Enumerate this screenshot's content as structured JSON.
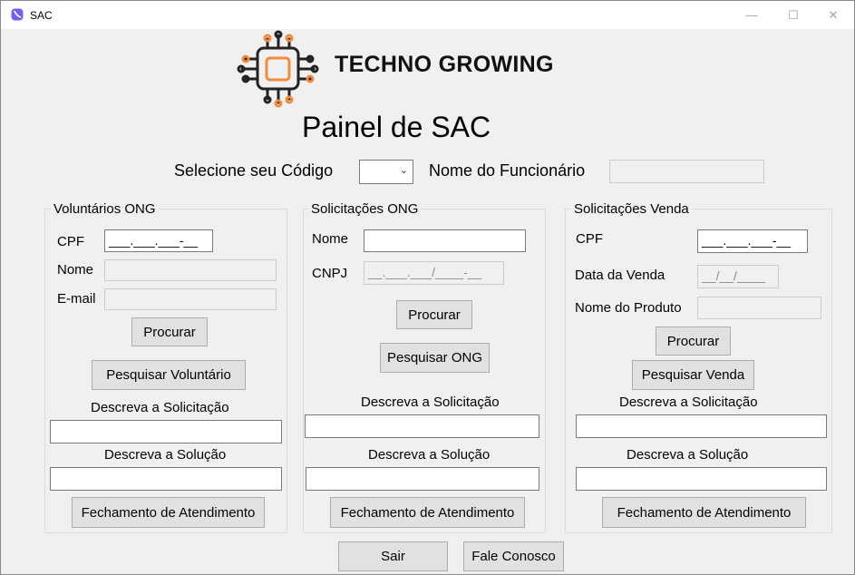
{
  "window": {
    "title": "SAC",
    "minimize_glyph": "—",
    "maximize_glyph": "☐",
    "close_glyph": "✕",
    "icon": "viber-icon",
    "icon_color": "#7360f2"
  },
  "header": {
    "brand": "TECHNO GROWING",
    "logo_icon": "circuit-chip-icon",
    "logo_accent": "#f08a3c",
    "heading": "Painel de SAC",
    "code_label": "Selecione seu Código",
    "code_value": "",
    "employee_label": "Nome do Funcionário",
    "employee_value": "",
    "dropdown_glyph": "⌄"
  },
  "volunteers": {
    "title": "Voluntários ONG",
    "cpf_label": "CPF",
    "cpf_mask": "___.___.___-__",
    "name_label": "Nome",
    "email_label": "E-mail",
    "search_button": "Procurar",
    "lookup_button": "Pesquisar Voluntário",
    "request_label": "Descreva a Solicitação",
    "solution_label": "Descreva  a Solução",
    "close_button": "Fechamento de Atendimento"
  },
  "ngo": {
    "title": "Solicitações  ONG",
    "name_label": "Nome",
    "cnpj_label": "CNPJ",
    "cnpj_mask": "__.___.___/____-__",
    "search_button": "Procurar",
    "lookup_button": "Pesquisar ONG",
    "request_label": "Descreva a Solicitação",
    "solution_label": "Descreva  a Solução",
    "close_button": "Fechamento de Atendimento"
  },
  "sales": {
    "title": "Solicitações Venda",
    "cpf_label": "CPF",
    "cpf_mask": "___.___.___-__",
    "date_label": "Data da Venda",
    "date_mask": "__/__/____",
    "product_label": "Nome do Produto",
    "search_button": "Procurar",
    "lookup_button": "Pesquisar Venda",
    "request_label": "Descreva a Solicitação",
    "solution_label": "Descreva  a Solução",
    "close_button": "Fechamento de Atendimento"
  },
  "footer": {
    "exit_button": "Sair",
    "contact_button": "Fale Conosco"
  }
}
